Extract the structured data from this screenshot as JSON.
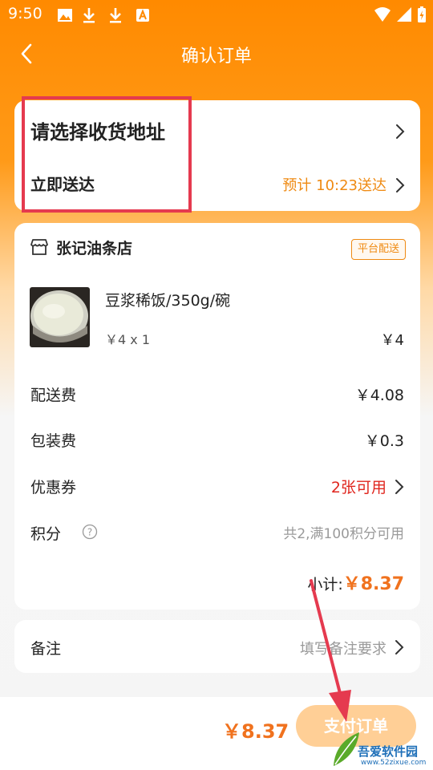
{
  "status_bar": {
    "time": "9:50"
  },
  "header": {
    "title": "确认订单"
  },
  "address": {
    "title": "请选择收货地址",
    "delivery_label": "立即送达",
    "delivery_estimate": "预计 10:23送达"
  },
  "shop": {
    "name": "张记油条店",
    "badge": "平台配送"
  },
  "item": {
    "name": "豆浆稀饭/350g/碗",
    "unit_price_qty": "￥4 x 1",
    "price": "￥4"
  },
  "fees": [
    {
      "label": "配送费",
      "value": "￥4.08"
    },
    {
      "label": "包装费",
      "value": "￥0.3"
    }
  ],
  "coupon": {
    "label": "优惠券",
    "value": "2张可用"
  },
  "points": {
    "label": "积分",
    "value": "共2,满100积分可用"
  },
  "subtotal": {
    "label": "小计:",
    "amount": "￥8.37"
  },
  "note": {
    "label": "备注",
    "placeholder": "填写备注要求"
  },
  "footer": {
    "total": "￥8.37",
    "pay_button": "支付订单"
  },
  "watermark": {
    "brand": "吾爱软件园",
    "url": "www.52zixue.com"
  },
  "colors": {
    "accent_orange": "#ff8a00",
    "price_orange": "#f0721e",
    "coupon_red": "#e0261e",
    "annotation_red": "#e53a4f"
  }
}
